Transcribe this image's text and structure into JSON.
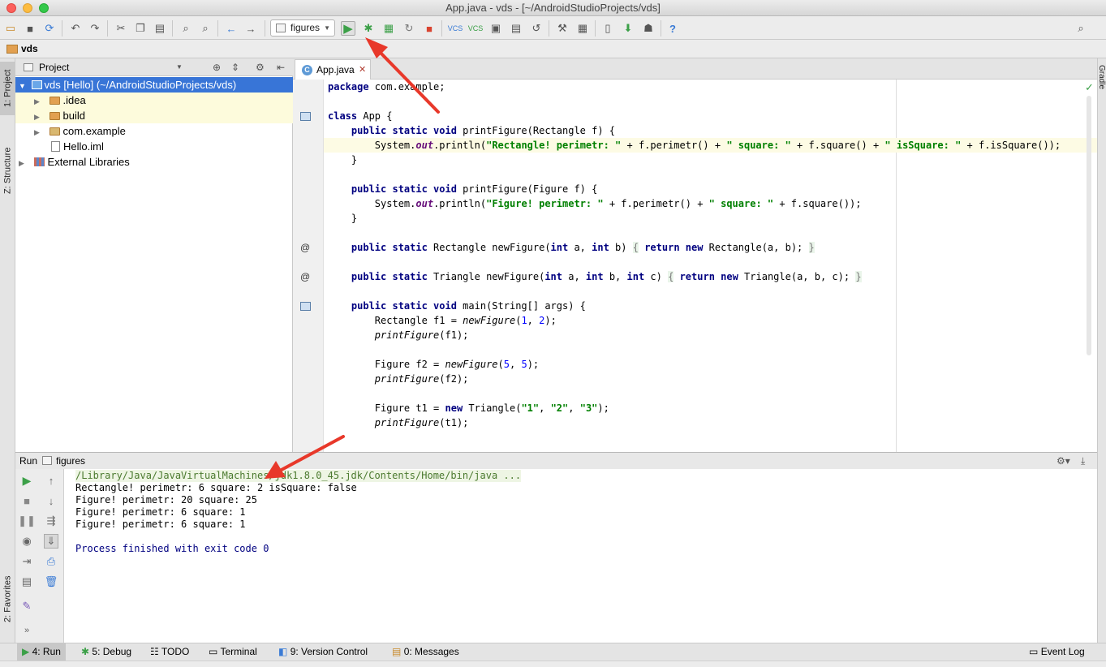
{
  "window": {
    "title": "App.java - vds - [~/AndroidStudioProjects/vds]"
  },
  "toolbar": {
    "run_config": "figures"
  },
  "navbar": {
    "breadcrumb": "vds"
  },
  "left_tabs": {
    "project": "1: Project",
    "structure": "Z: Structure",
    "favorites": "2: Favorites"
  },
  "right_tabs": {
    "gradle": "Gradle"
  },
  "project_panel": {
    "header": "Project",
    "tree": [
      {
        "label": "vds [Hello] (~/AndroidStudioProjects/vds)",
        "type": "module"
      },
      {
        "label": ".idea",
        "type": "folder"
      },
      {
        "label": "build",
        "type": "folder"
      },
      {
        "label": "com.example",
        "type": "package"
      },
      {
        "label": "Hello.iml",
        "type": "file"
      },
      {
        "label": "External Libraries",
        "type": "libraries"
      }
    ]
  },
  "editor": {
    "tab": "App.java"
  },
  "run_panel": {
    "header_label": "Run",
    "config_name": "figures",
    "output": [
      "/Library/Java/JavaVirtualMachines/jdk1.8.0_45.jdk/Contents/Home/bin/java ...",
      "Rectangle! perimetr: 6 square: 2 isSquare: false",
      "Figure! perimetr: 20 square: 25",
      "Figure! perimetr: 6 square: 1",
      "Figure! perimetr: 6 square: 1",
      "",
      "Process finished with exit code 0"
    ]
  },
  "bottom_tabs": {
    "run": "4: Run",
    "debug": "5: Debug",
    "todo": "TODO",
    "terminal": "Terminal",
    "vcs": "9: Version Control",
    "messages": "0: Messages",
    "event_log": "Event Log"
  },
  "colors": {
    "accent_selection": "#3875d7",
    "run_green": "#3ca048",
    "annotation_arrow": "#e8382a"
  }
}
